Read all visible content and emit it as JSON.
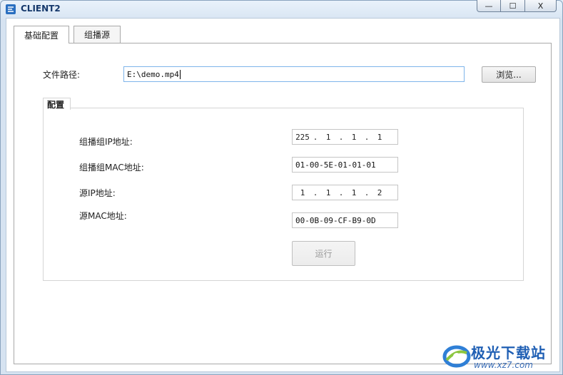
{
  "window": {
    "title": "CLIENT2",
    "controls": {
      "minimize": "—",
      "maximize": "☐",
      "close": "X"
    }
  },
  "tabs": [
    {
      "label": "基础配置",
      "active": true
    },
    {
      "label": "组播源",
      "active": false
    }
  ],
  "file": {
    "label": "文件路径:",
    "value": "E:\\demo.mp4",
    "browse_label": "浏览..."
  },
  "config": {
    "group_title": "配置",
    "multicast_ip": {
      "label": "组播组IP地址:",
      "octets": [
        "225",
        "1",
        "1",
        "1"
      ]
    },
    "multicast_mac": {
      "label": "组播组MAC地址:",
      "value": "01-00-5E-01-01-01"
    },
    "source_ip": {
      "label": "源IP地址:",
      "octets": [
        "1",
        "1",
        "1",
        "2"
      ]
    },
    "source_mac": {
      "label": "源MAC地址:",
      "value": "00-0B-09-CF-B9-0D"
    },
    "run_label": "运行",
    "run_enabled": false
  },
  "watermark": {
    "title": "极光下载站",
    "url": "www.xz7.com"
  },
  "colors": {
    "title_text": "#15386b",
    "focus_border": "#7eb4ea",
    "watermark_blue": "#1f5fb4"
  }
}
